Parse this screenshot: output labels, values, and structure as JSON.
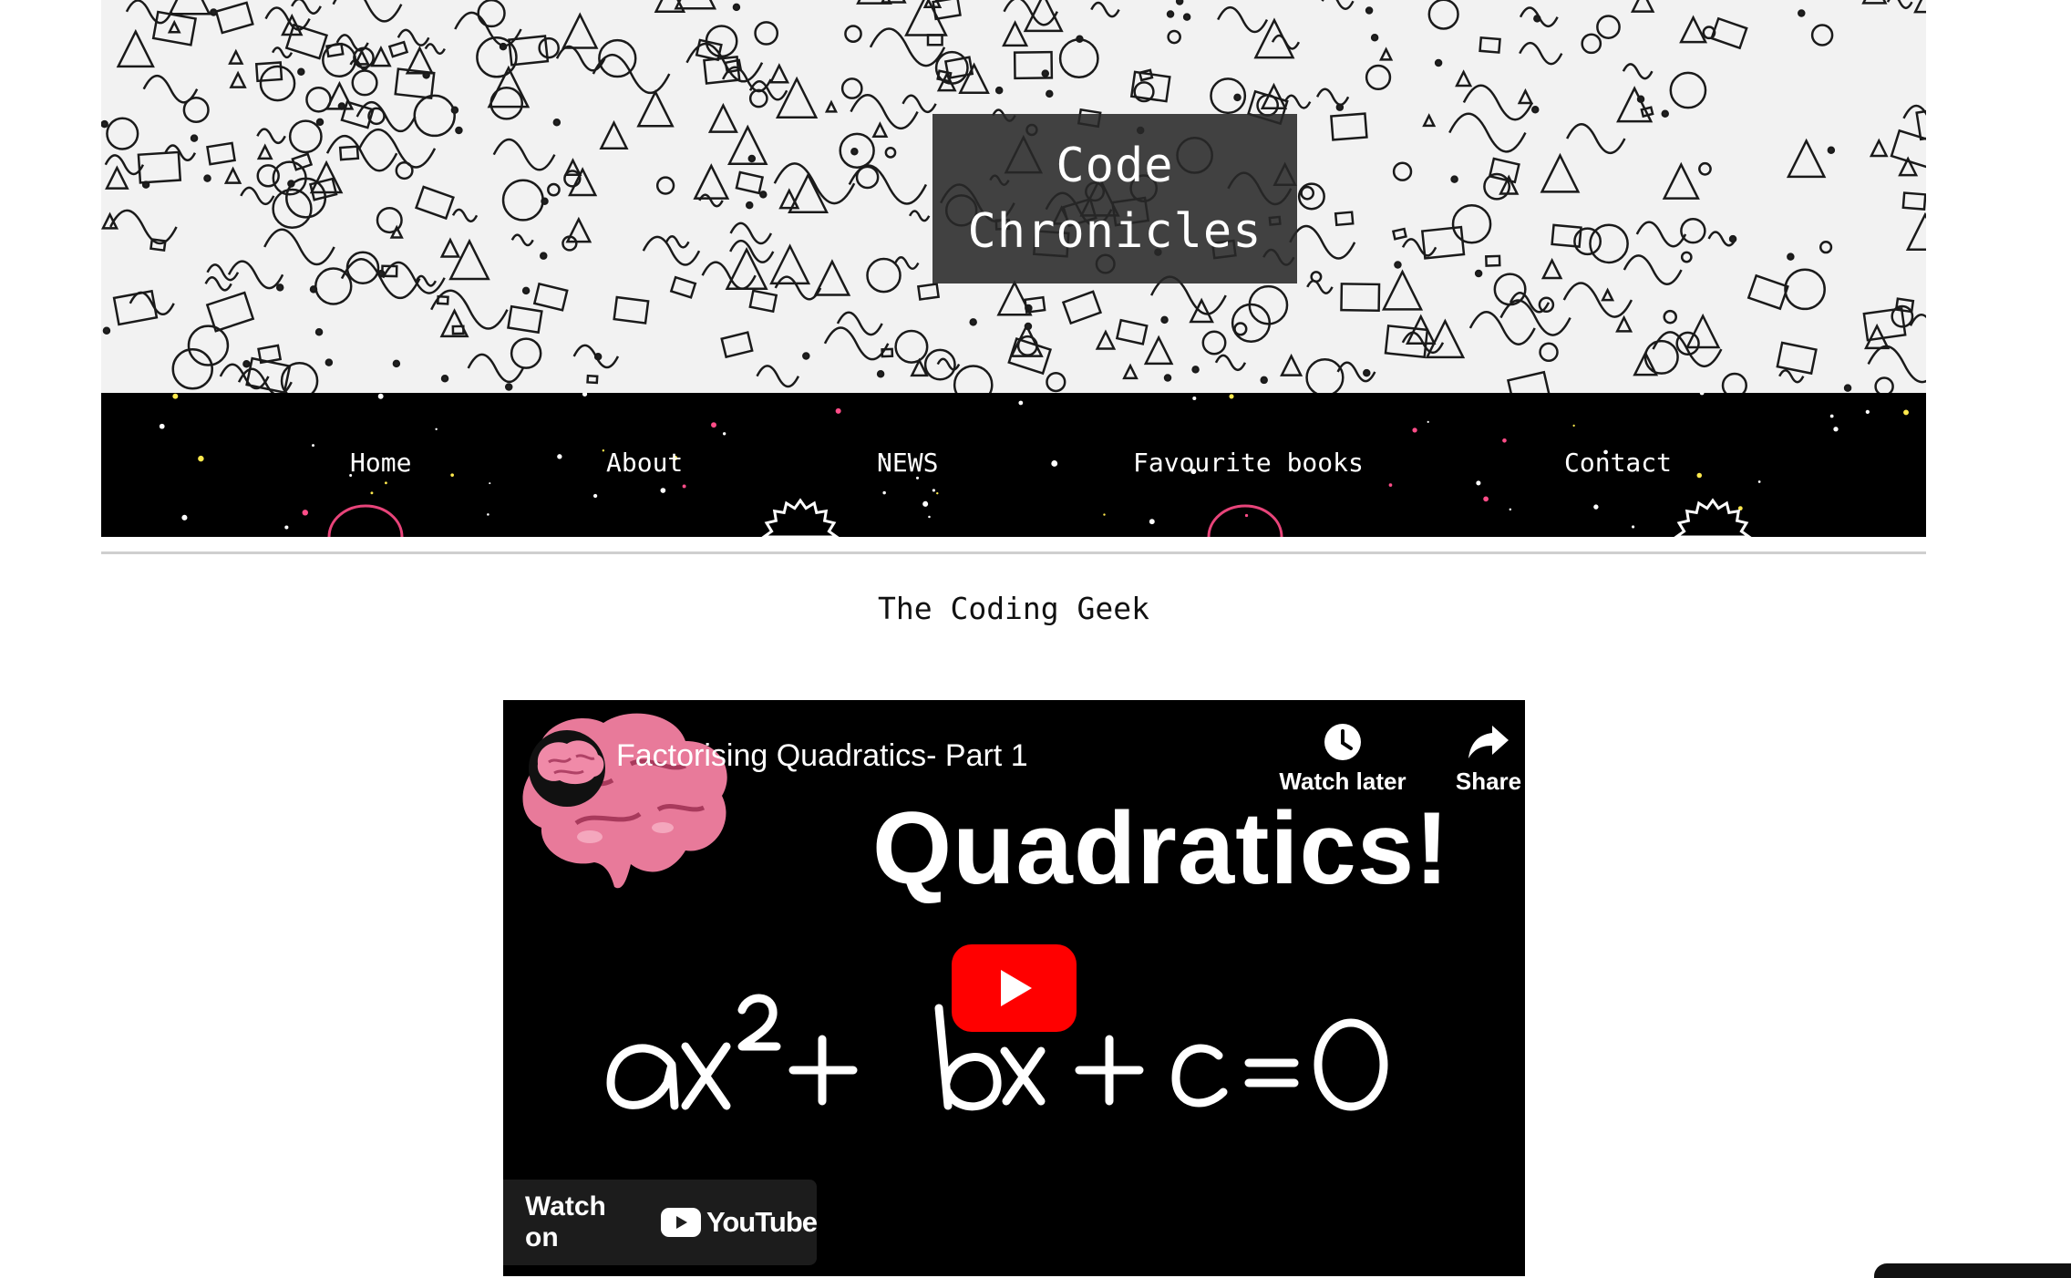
{
  "site": {
    "title_line1": "Code",
    "title_line2": "Chronicles",
    "subtitle": "The Coding Geek"
  },
  "nav": {
    "items": [
      {
        "label": "Home"
      },
      {
        "label": "About"
      },
      {
        "label": "NEWS"
      },
      {
        "label": "Favourite books"
      },
      {
        "label": "Contact"
      }
    ]
  },
  "video": {
    "title": "Factorising Quadratics- Part 1",
    "heading": "Quadratics!",
    "equation": "ax² + bx + c = 0",
    "watch_later_label": "Watch later",
    "share_label": "Share",
    "watch_on_label": "Watch on",
    "youtube_wordmark": "YouTube",
    "icons": {
      "channel": "brain-icon",
      "watch_later": "clock-icon",
      "share": "share-arrow-icon",
      "play": "youtube-play-icon"
    }
  },
  "colors": {
    "youtube_red": "#ff0000",
    "brain_pink": "#e87a9a",
    "nav_background": "#000000"
  }
}
